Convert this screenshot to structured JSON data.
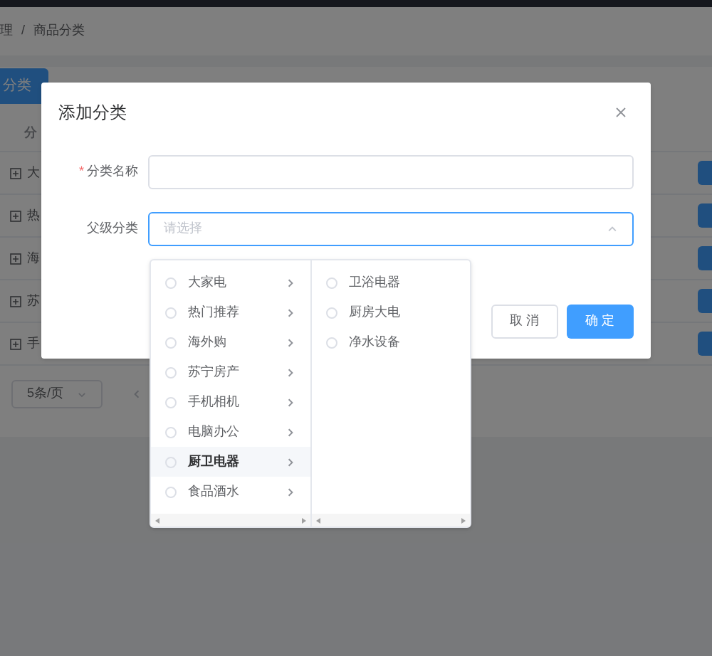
{
  "breadcrumb": {
    "items": [
      "理",
      "商品分类"
    ],
    "separator": "/"
  },
  "add_button": "分类",
  "table": {
    "columns": [
      "分"
    ],
    "rows": [
      {
        "name": "大"
      },
      {
        "name": "热"
      },
      {
        "name": "海"
      },
      {
        "name": "苏"
      },
      {
        "name": "手"
      }
    ]
  },
  "pagination": {
    "page_size": "5条/页"
  },
  "dialog": {
    "title": "添加分类",
    "fields": [
      {
        "kind": "input",
        "label": "分类名称",
        "required_mark": "*"
      },
      {
        "kind": "select",
        "label": "父级分类",
        "placeholder": "请选择",
        "expanded": true
      }
    ],
    "buttons": [
      {
        "label": "取 消",
        "primary": false
      },
      {
        "label": "确 定",
        "primary": true
      }
    ]
  },
  "cascader": {
    "columns": [
      [
        {
          "label": "大家电",
          "selected": false,
          "has_children": true
        },
        {
          "label": "热门推荐",
          "selected": false,
          "has_children": true
        },
        {
          "label": "海外购",
          "selected": false,
          "has_children": true
        },
        {
          "label": "苏宁房产",
          "selected": false,
          "has_children": true
        },
        {
          "label": "手机相机",
          "selected": false,
          "has_children": true
        },
        {
          "label": "电脑办公",
          "selected": false,
          "has_children": true
        },
        {
          "label": "厨卫电器",
          "selected": true,
          "has_children": true
        },
        {
          "label": "食品酒水",
          "selected": false,
          "has_children": true
        }
      ],
      [
        {
          "label": "卫浴电器",
          "selected": false,
          "has_children": false
        },
        {
          "label": "厨房大电",
          "selected": false,
          "has_children": false
        },
        {
          "label": "净水设备",
          "selected": false,
          "has_children": false
        }
      ]
    ]
  }
}
